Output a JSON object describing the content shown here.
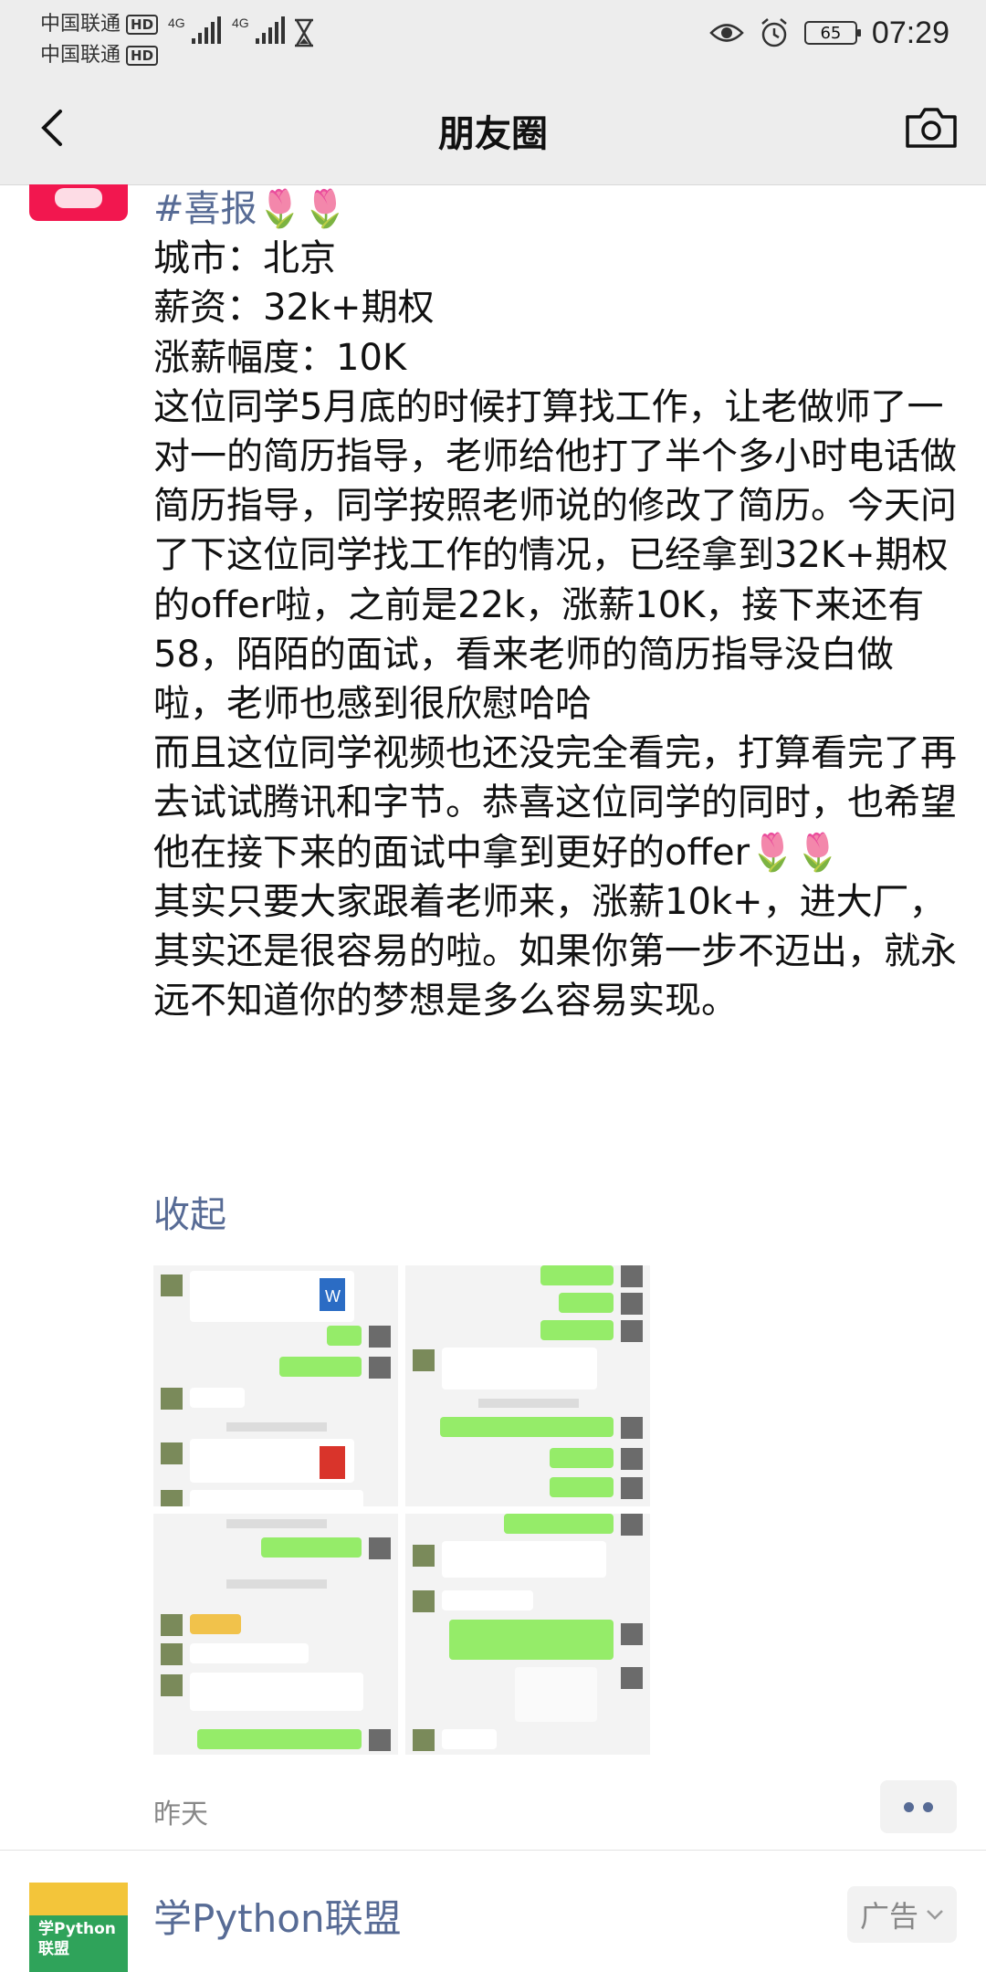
{
  "status_bar": {
    "carrier1": "中国联通",
    "carrier2": "中国联通",
    "hd": "HD",
    "network1": "4G",
    "network2": "4G",
    "battery": "65",
    "time": "07:29"
  },
  "nav": {
    "title": "朋友圈",
    "back_icon": "chevron-left-icon",
    "camera_icon": "camera-icon"
  },
  "post": {
    "tag_line": "#喜报🌷🌷",
    "lines": [
      "城市：北京",
      "薪资：32k+期权",
      "涨薪幅度：10K",
      "这位同学5月底的时候打算找工作，让老做师了一对一的简历指导，老师给他打了半个多小时电话做简历指导，同学按照老师说的修改了简历。今天问了下这位同学找工作的情况，已经拿到32K+期权的offer啦，之前是22k，涨薪10K，接下来还有58，陌陌的面试，看来老师的简历指导没白做啦，老师也感到很欣慰哈哈",
      "而且这位同学视频也还没完全看完，打算看完了再去试试腾讯和字节。恭喜这位同学的同时，也希望他在接下来的面试中拿到更好的offer🌷🌷",
      "其实只要大家跟着老师来，涨薪10k+，进大厂，其实还是很容易的啦。如果你第一步不迈出，就永远不知道你的梦想是多么容易实现。"
    ],
    "collapse": "收起",
    "time": "昨天"
  },
  "ad": {
    "name": "学Python联盟",
    "avatar_label": "学Python联盟",
    "badge": "广告"
  },
  "colors": {
    "link": "#576b95",
    "bar_bg": "#ededed",
    "chat_green": "#95ec69"
  }
}
